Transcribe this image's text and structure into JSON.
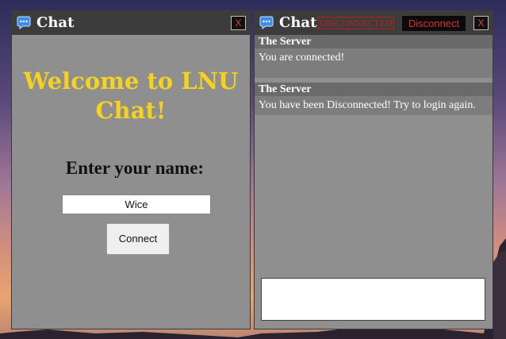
{
  "colors": {
    "accent_title": "#f5d21e",
    "status_red": "#c02020",
    "window_bg": "#8f8f8f",
    "titlebar_bg": "#3c3c3c"
  },
  "login_window": {
    "title": "Chat",
    "icon": "chat-bubble-icon",
    "close_label": "X",
    "welcome_text": "Welcome to LNU Chat!",
    "name_prompt": "Enter your name:",
    "name_value": "Wice",
    "connect_label": "Connect"
  },
  "chat_window": {
    "title": "Chat",
    "icon": "chat-bubble-icon",
    "status_text": "DISCONNECTED",
    "disconnect_label": "Disconnect",
    "close_label": "X",
    "messages": [
      {
        "sender": "The Server",
        "text": "You are connected!"
      },
      {
        "sender": "The Server",
        "text": "You have been Disconnected! Try to login again."
      }
    ],
    "compose_value": ""
  }
}
